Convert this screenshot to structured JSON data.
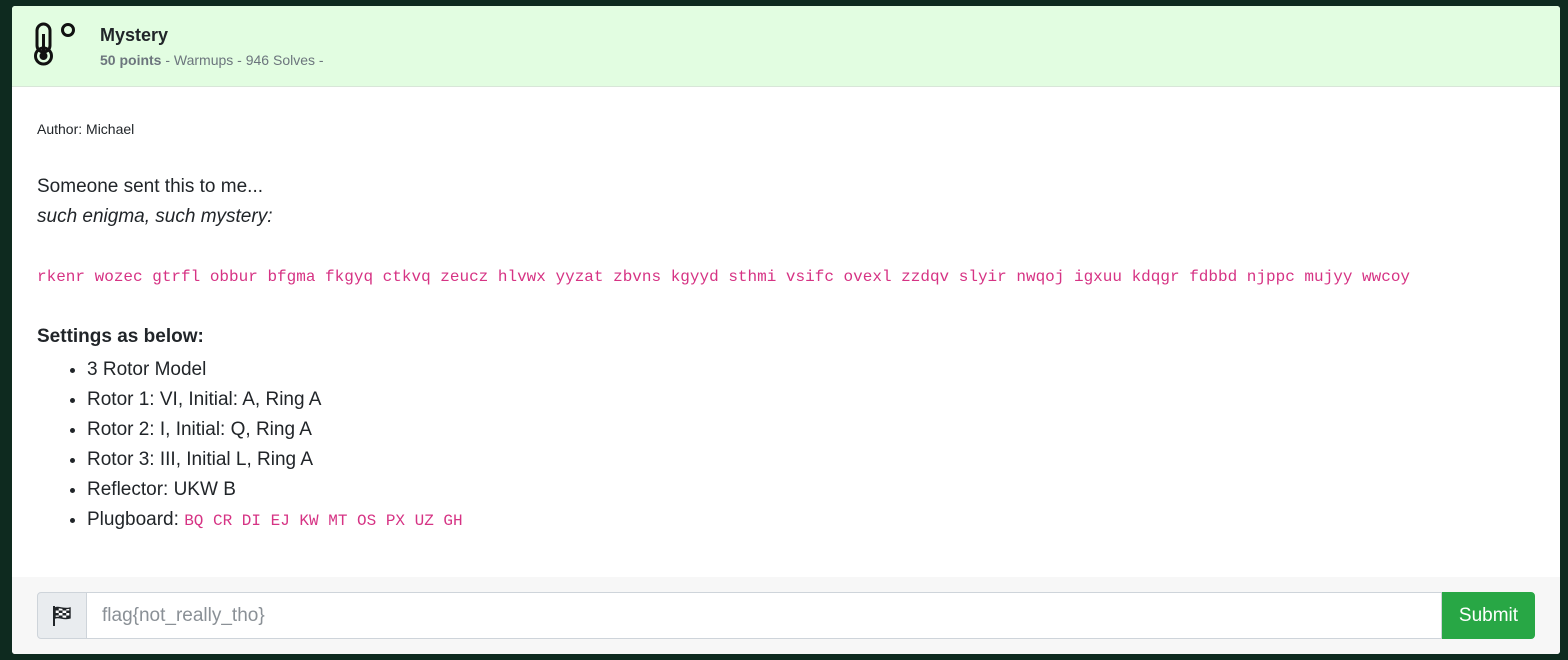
{
  "challenge": {
    "title": "Mystery",
    "points": "50 points",
    "meta_rest": " - Warmups - 946 Solves -",
    "category_icon": "thermometer-icon"
  },
  "body": {
    "author": "Author: Michael",
    "line1": "Someone sent this to me...",
    "line2": "such enigma, such mystery:",
    "ciphertext": "rkenr wozec gtrfl obbur bfgma fkgyq ctkvq zeucz hlvwx yyzat zbvns kgyyd sthmi vsifc ovexl zzdqv slyir nwqoj igxuu kdqgr fdbbd njppc mujyy wwcoy",
    "settings_heading": "Settings as below:",
    "settings": [
      "3 Rotor Model",
      "Rotor 1: VI, Initial: A, Ring A",
      "Rotor 2: I, Initial: Q, Ring A",
      "Rotor 3: III, Initial L, Ring A",
      "Reflector: UKW B"
    ],
    "plugboard_label": "Plugboard: ",
    "plugboard_value": "BQ CR DI EJ KW MT OS PX UZ GH"
  },
  "footer": {
    "flag_icon": "checkered-flag-icon",
    "input_placeholder": "flag{not_really_tho}",
    "input_value": "",
    "submit_label": "Submit"
  },
  "colors": {
    "header_bg": "#e2fde1",
    "code": "#d63384",
    "submit": "#28a745",
    "page_bg": "#0e2a1f"
  }
}
